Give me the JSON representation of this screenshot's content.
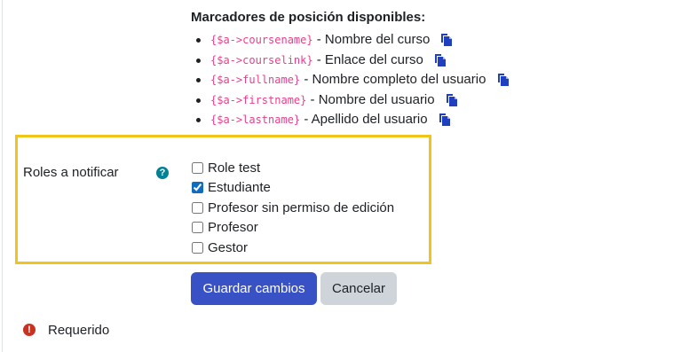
{
  "placeholders": {
    "title": "Marcadores de posición disponibles:",
    "items": [
      {
        "code": "{$a->coursename}",
        "desc": "- Nombre del curso"
      },
      {
        "code": "{$a->courselink}",
        "desc": "- Enlace del curso"
      },
      {
        "code": "{$a->fullname}",
        "desc": "- Nombre completo del usuario"
      },
      {
        "code": "{$a->firstname}",
        "desc": "- Nombre del usuario"
      },
      {
        "code": "{$a->lastname}",
        "desc": "- Apellido del usuario"
      }
    ]
  },
  "roles": {
    "label": "Roles a notificar",
    "help_icon": "?",
    "options": [
      {
        "label": "Role test",
        "checked": false
      },
      {
        "label": "Estudiante",
        "checked": true
      },
      {
        "label": "Profesor sin permiso de edición",
        "checked": false
      },
      {
        "label": "Profesor",
        "checked": false
      },
      {
        "label": "Gestor",
        "checked": false
      }
    ]
  },
  "buttons": {
    "save": "Guardar cambios",
    "cancel": "Cancelar"
  },
  "required": {
    "icon": "!",
    "text": "Requerido"
  },
  "colors": {
    "highlight_border": "#f0c419",
    "primary_button": "#3851c4",
    "secondary_button": "#ced4da",
    "code_text": "#e83e8c",
    "copy_icon": "#1f3fbf",
    "help_icon": "#008196",
    "required_icon": "#ca3120"
  }
}
